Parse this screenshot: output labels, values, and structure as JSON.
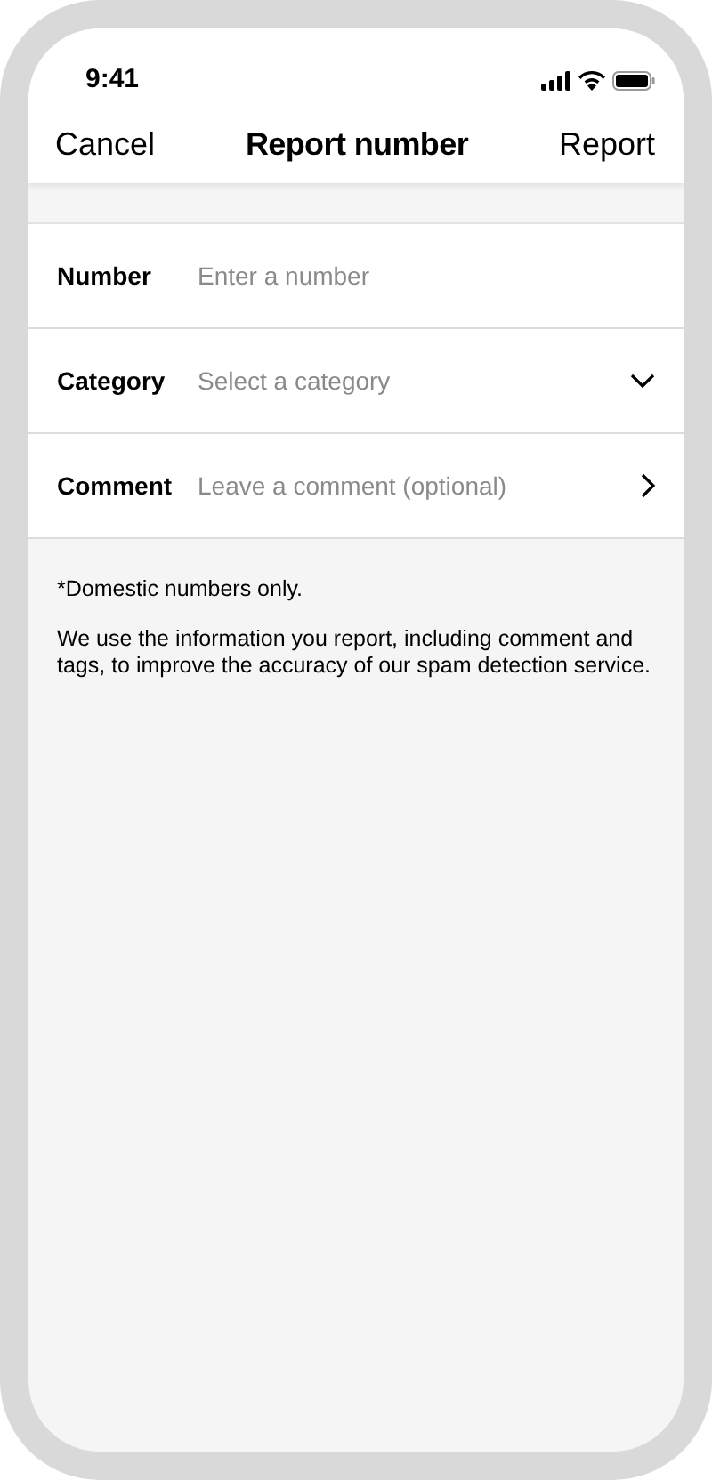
{
  "status_bar": {
    "time": "9:41"
  },
  "nav_bar": {
    "left_action": "Cancel",
    "title": "Report number",
    "right_action": "Report"
  },
  "fields": [
    {
      "kind": "text",
      "label": "Number",
      "placeholder": "Enter a number"
    },
    {
      "kind": "select",
      "label": "Category",
      "placeholder": "Select a category"
    },
    {
      "kind": "link",
      "label": "Comment",
      "placeholder": "Leave a comment (optional)"
    }
  ],
  "notes": [
    "*Domestic numbers only.",
    "We use the information you report, including comment and tags, to improve the accuracy of our spam detection service."
  ]
}
